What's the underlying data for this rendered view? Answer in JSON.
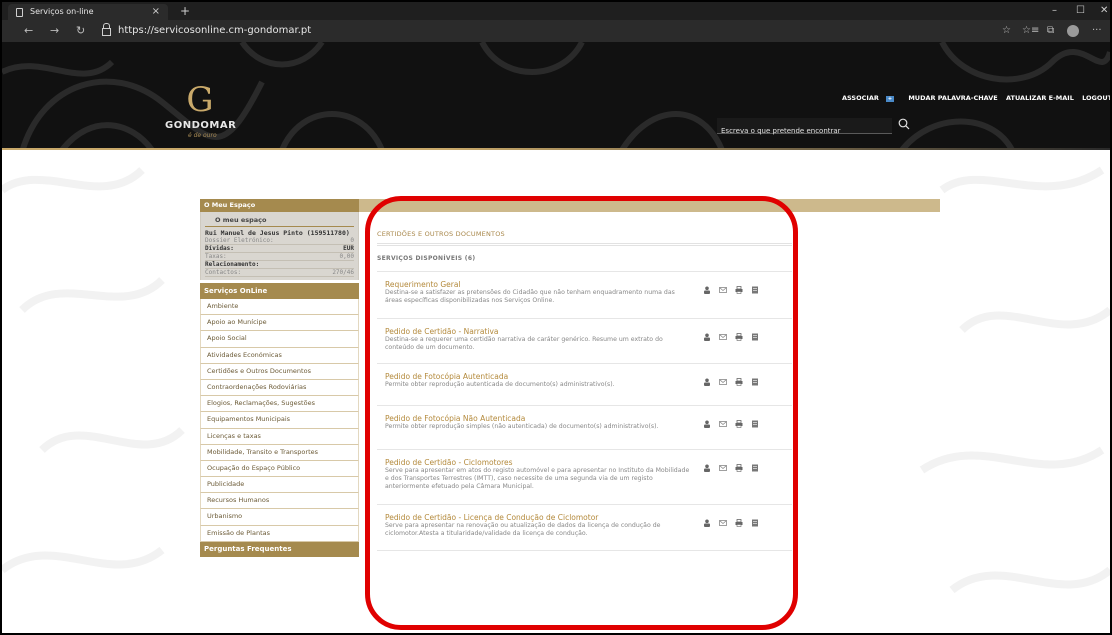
{
  "browser": {
    "tab_title": "Serviços on-line",
    "tab_close": "×",
    "new_tab": "+",
    "url": "https://servicosonline.cm-gondomar.pt",
    "nav": {
      "back": "←",
      "forward": "→",
      "refresh": "↻"
    },
    "tools": {
      "star": "☆",
      "favorites": "☆≡",
      "collections": "⧉",
      "more": "···"
    },
    "window": {
      "minimize": "–",
      "maximize": "☐",
      "close": "✕"
    }
  },
  "header": {
    "logo_letter": "G",
    "logo_text": "GONDOMAR",
    "logo_sub": "é de ouro",
    "links": {
      "associar": "ASSOCIAR",
      "associar_badge": "+",
      "mudar": "MUDAR PALAVRA-CHAVE",
      "atualizar": "ATUALIZAR E-MAIL",
      "logout": "LOGOUT"
    },
    "search_placeholder": "Escreva o que pretende encontrar"
  },
  "sidebar": {
    "my_space_header": "O Meu Espaço",
    "my_space_sub": "O meu espaço",
    "user_name": "Rui Manuel de Jesus Pinto (159511780)",
    "dossier_label": "Dossier Eletrónico:",
    "dossier_value": "0",
    "debts_label": "Dívidas:",
    "debts_value": "EUR",
    "fees_label": "Taxas:",
    "fees_value": "0,00",
    "relation_label": "Relacionamento:",
    "contacts_label": "Contactos:",
    "contacts_value": "270/46",
    "services_header": "Serviços OnLine",
    "items": [
      "Ambiente",
      "Apoio ao Munícipe",
      "Apoio Social",
      "Atividades Económicas",
      "Certidões e Outros Documentos",
      "Contraordenações Rodoviárias",
      "Elogios, Reclamações, Sugestões",
      "Equipamentos Municipais",
      "Licenças e taxas",
      "Mobilidade, Transito e Transportes",
      "Ocupação do Espaço Público",
      "Publicidade",
      "Recursos Humanos",
      "Urbanismo",
      "Emissão de Plantas"
    ],
    "faq": "Perguntas Frequentes"
  },
  "main": {
    "section_title": "CERTIDÕES E OUTROS DOCUMENTOS",
    "available": "SERVIÇOS DISPONÍVEIS (6)",
    "services": [
      {
        "title": "Requerimento Geral",
        "desc": "Destina-se a satisfazer as pretensões do Cidadão que não tenham enquadramento numa das áreas específicas disponibilizadas nos Serviços Online."
      },
      {
        "title": "Pedido de Certidão - Narrativa",
        "desc": "Destina-se a requerer uma certidão narrativa de caráter genérico. Resume um extrato do conteúdo de um documento."
      },
      {
        "title": "Pedido de Fotocópia Autenticada",
        "desc": "Permite obter reprodução autenticada de documento(s) administrativo(s)."
      },
      {
        "title": "Pedido de Fotocópia Não Autenticada",
        "desc": "Permite obter reprodução simples (não autenticada) de documento(s) administrativo(s)."
      },
      {
        "title": "Pedido de Certidão - Ciclomotores",
        "desc": "Serve para apresentar em atos do registo automóvel e para apresentar no Instituto da Mobilidade e dos Transportes Terrestres (IMTT), caso necessite de uma segunda via de um registo anteriormente efetuado pela Câmara Municipal."
      },
      {
        "title": "Pedido de Certidão - Licença de Condução de Ciclomotor",
        "desc": "Serve para apresentar na renovação ou atualização de dados da licença de condução de ciclomotor.Atesta a titularidade/validade da licença de condução."
      }
    ]
  },
  "colors": {
    "gold": "#a58a4e",
    "gold_light": "#cdb98c",
    "link_gold": "#b48a3c",
    "highlight_red": "#e00000",
    "header_dark": "#111111"
  },
  "icons": [
    "page-icon",
    "lock-icon",
    "search-icon",
    "user-icon",
    "mail-icon",
    "printer-icon",
    "document-icon"
  ]
}
